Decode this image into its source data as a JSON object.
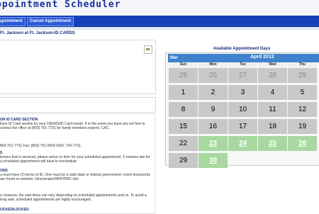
{
  "app": {
    "title": "ppointment Scheduler"
  },
  "nav": {
    "items": [
      {
        "label": "ppointment"
      },
      {
        "label": "Cancel Appointment"
      }
    ]
  },
  "location": {
    "text": "Ft. Jackson at Ft. Jackson-ID CARDS"
  },
  "sections": [
    {
      "heading": "ON ID CARD SECTION",
      "text": "kson ID Card section for your DEERS/ID Card needs. If in the event you have any eel free to contact the office at (803) 751-7731 for family members expires. CAC."
    },
    {
      "heading": "",
      "text": "803-751-7731 Fax: (803) 751-6554 DSN: 734-7731,"
    },
    {
      "heading": "S",
      "text": "tomers that is serviced, please arrive on time for your scheduled appointment. 5 minutes late for a scheduled appointment will have to reschedule."
    },
    {
      "heading": "ONS",
      "text": "u must have (2) forms of ID. One must be a valid state or federal government- roved documents are found on website: Directorates/HRP/PWC.htm"
    },
    {
      "heading": "",
      "text": "s; however, the wait times can vary depending on scheduled appointments and ns. To avoid a long wait, scheduled appointments are highly encouraged."
    },
    {
      "heading": "OCKED/LOCKED",
      "text": ""
    }
  ],
  "calendar": {
    "title": "Available Appointment Days",
    "prev_label": "Mar",
    "month_label": "April 2012",
    "weekdays": [
      "Sun",
      "Mon",
      "Tue",
      "Wed",
      "Thu"
    ],
    "weeks": [
      [
        {
          "d": "25",
          "s": "prev"
        },
        {
          "d": "26",
          "s": "prev"
        },
        {
          "d": "27",
          "s": "prev"
        },
        {
          "d": "28",
          "s": "prev"
        },
        {
          "d": "29",
          "s": "prev"
        }
      ],
      [
        {
          "d": "1",
          "s": "cur"
        },
        {
          "d": "2",
          "s": "cur"
        },
        {
          "d": "3",
          "s": "cur"
        },
        {
          "d": "4",
          "s": "cur"
        },
        {
          "d": "5",
          "s": "cur"
        }
      ],
      [
        {
          "d": "8",
          "s": "cur"
        },
        {
          "d": "9",
          "s": "cur"
        },
        {
          "d": "10",
          "s": "cur"
        },
        {
          "d": "11",
          "s": "cur"
        },
        {
          "d": "12",
          "s": "cur"
        }
      ],
      [
        {
          "d": "15",
          "s": "cur"
        },
        {
          "d": "16",
          "s": "cur"
        },
        {
          "d": "17",
          "s": "cur"
        },
        {
          "d": "18",
          "s": "cur"
        },
        {
          "d": "19",
          "s": "cur"
        }
      ],
      [
        {
          "d": "22",
          "s": "cur"
        },
        {
          "d": "23",
          "s": "avail"
        },
        {
          "d": "24",
          "s": "avail"
        },
        {
          "d": "25",
          "s": "avail"
        },
        {
          "d": "26",
          "s": "avail"
        }
      ],
      [
        {
          "d": "29",
          "s": "cur"
        },
        {
          "d": "30",
          "s": "avail"
        }
      ]
    ]
  }
}
